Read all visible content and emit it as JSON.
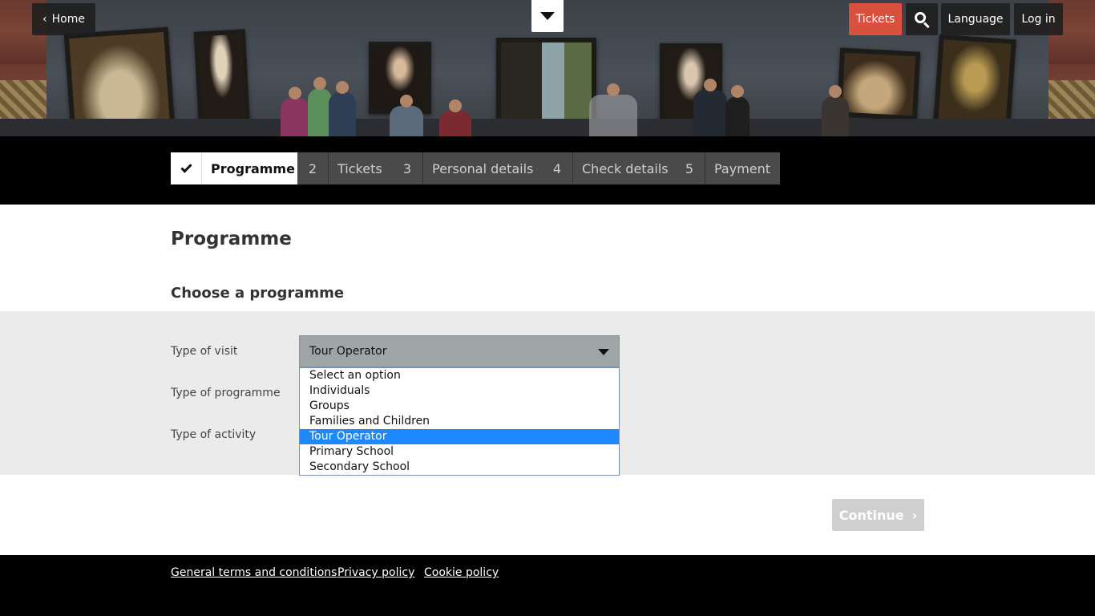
{
  "header": {
    "home_label": "Home",
    "tickets_label": "Tickets",
    "language_label": "Language",
    "login_label": "Log in",
    "icons": {
      "home_chevron": "chevron-left-icon",
      "dropdown": "caret-down-icon",
      "search": "search-icon"
    }
  },
  "steps": [
    {
      "num": "",
      "label": "Programme",
      "state": "done"
    },
    {
      "num": "2",
      "label": "Tickets",
      "state": "pending"
    },
    {
      "num": "3",
      "label": "Personal details",
      "state": "pending"
    },
    {
      "num": "4",
      "label": "Check details",
      "state": "pending"
    },
    {
      "num": "5",
      "label": "Payment",
      "state": "pending"
    }
  ],
  "main": {
    "title": "Programme",
    "section_title": "Choose a programme",
    "fields": {
      "visit_label": "Type of visit",
      "programme_label": "Type of programme",
      "activity_label": "Type of activity"
    },
    "visit_select": {
      "value": "Tour Operator",
      "options": [
        "Select an option",
        "Individuals",
        "Groups",
        "Families and Children",
        "Tour Operator",
        "Primary School",
        "Secondary School"
      ]
    },
    "continue_label": "Continue"
  },
  "footer": {
    "terms": "General terms and conditions",
    "privacy": "Privacy policy",
    "cookie": "Cookie policy"
  },
  "colors": {
    "accent_red": "#d9503f",
    "selected_blue": "#1e88ff",
    "select_bg": "#9ea5a6",
    "band_bg": "#ebebeb"
  }
}
